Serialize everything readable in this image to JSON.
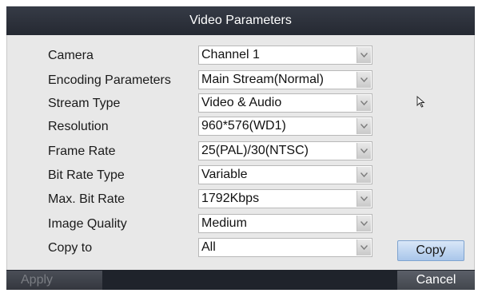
{
  "dialog": {
    "title": "Video Parameters"
  },
  "fields": [
    {
      "label": "Camera",
      "value": "Channel 1"
    },
    {
      "label": "Encoding Parameters",
      "value": "Main Stream(Normal)"
    },
    {
      "label": "Stream Type",
      "value": "Video & Audio"
    },
    {
      "label": "Resolution",
      "value": "960*576(WD1)"
    },
    {
      "label": "Frame Rate",
      "value": "25(PAL)/30(NTSC)"
    },
    {
      "label": "Bit Rate Type",
      "value": "Variable"
    },
    {
      "label": "Max. Bit Rate",
      "value": "1792Kbps"
    },
    {
      "label": "Image Quality",
      "value": "Medium"
    },
    {
      "label": "Copy to",
      "value": "All"
    }
  ],
  "buttons": {
    "copy": "Copy",
    "apply": "Apply",
    "cancel": "Cancel"
  },
  "icons": {
    "dropdown": "chevron-down-icon",
    "cursor": "mouse-pointer-icon"
  }
}
